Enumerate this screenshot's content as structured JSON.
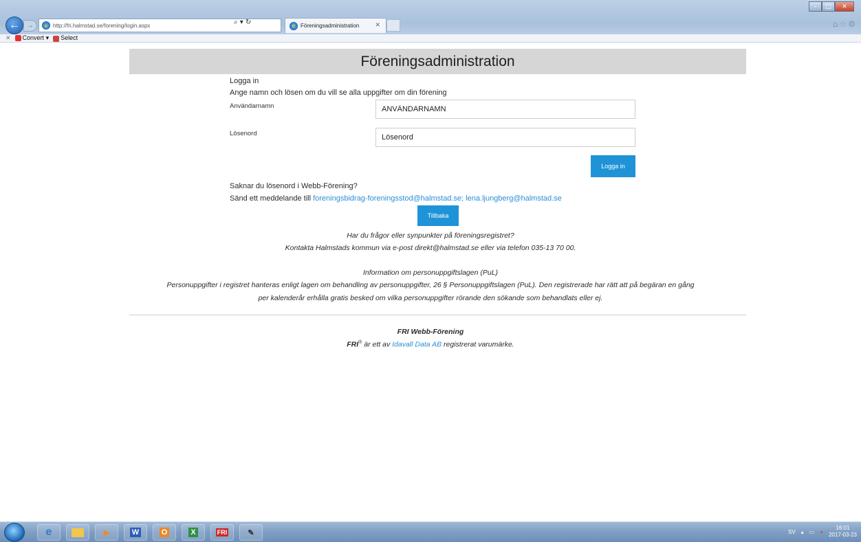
{
  "browser": {
    "address": "http://fri.halmstad.se/forening/login.aspx",
    "address_host_bold": "fri.halmstad.se",
    "tab_title": "Föreningsadministration",
    "commands": {
      "convert": "Convert",
      "select": "Select"
    }
  },
  "page": {
    "header": "Föreningsadministration",
    "login_heading": "Logga in",
    "login_intro": "Ange namn och lösen om du vill se alla uppgifter om din förening",
    "username_label": "Användarnamn",
    "username_value": "ANVÄNDARNAMN",
    "password_label": "Lösenord",
    "password_value": "Lösenord",
    "login_button": "Logga in",
    "missing_pw_q": "Saknar du lösenord i Webb-Förening?",
    "send_msg_prefix": "Sänd ett meddelande till",
    "send_msg_emails": "foreningsbidrag-foreningsstod@halmstad.se; lena.ljungberg@halmstad.se",
    "back_button": "Tillbaka",
    "questions_line1": "Har du frågor eller synpunkter på föreningsregistret?",
    "questions_line2": "Kontakta Halmstads kommun via e-post direkt@halmstad.se eller via telefon 035-13 70 00.",
    "pul_heading": "Information om personuppgiftslagen (PuL)",
    "pul_text1": "Personuppgifter i registret hanteras enligt lagen om behandling av personuppgifter, 26 § Personuppgiftslagen (PuL). Den registrerade har rätt att på begäran en gång",
    "pul_text2": "per kalenderår erhålla gratis besked om vilka personuppgifter rörande den sökande som behandlats eller ej.",
    "footer_title": "FRI Webb-Förening",
    "footer_brand": "FRI",
    "footer_reg": "®",
    "footer_mid": " är ett av ",
    "footer_company": "Idavall Data AB",
    "footer_end": " registrerat varumärke."
  },
  "taskbar": {
    "language": "SV",
    "time": "16:01",
    "date": "2017-03-23"
  }
}
